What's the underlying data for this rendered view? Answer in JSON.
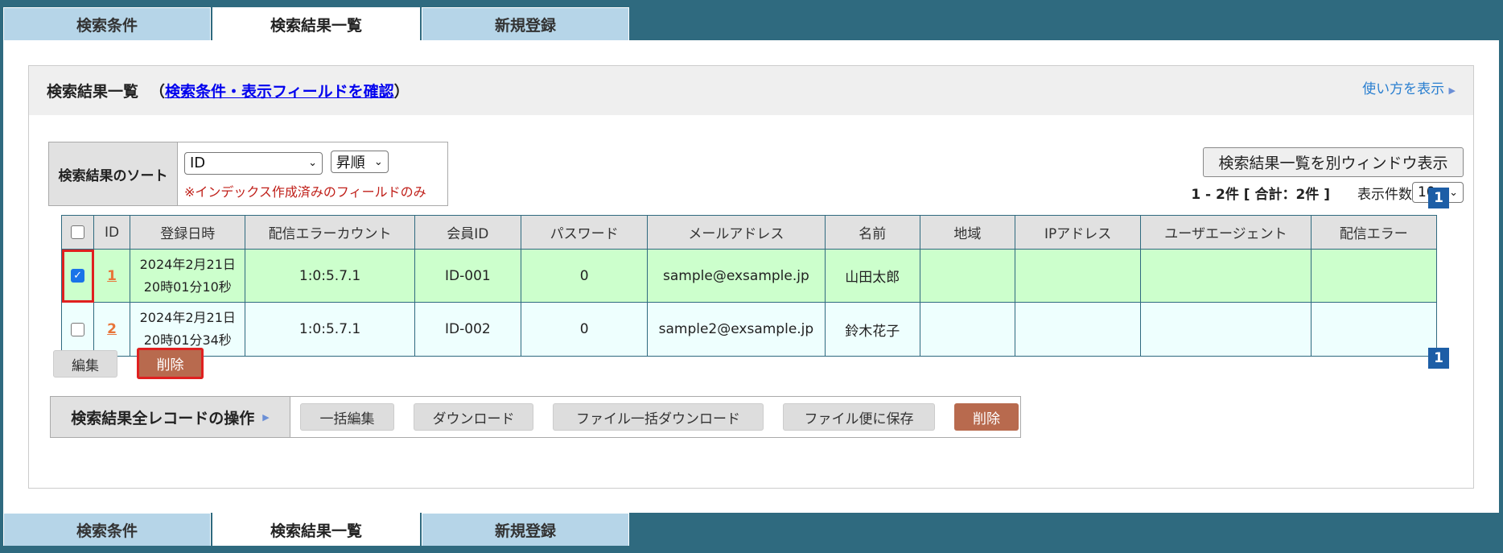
{
  "tabs": [
    {
      "label": "検索条件",
      "active": false
    },
    {
      "label": "検索結果一覧",
      "active": true
    },
    {
      "label": "新規登録",
      "active": false
    }
  ],
  "header": {
    "title": "検索結果一覧",
    "paren_open": "（",
    "link": "検索条件・表示フィールドを確認",
    "paren_close": "）",
    "howto": "使い方を表示",
    "howto_arrow": "▶"
  },
  "sort": {
    "label": "検索結果のソート",
    "field_value": "ID",
    "order_value": "昇順",
    "note": "※インデックス作成済みのフィールドのみ"
  },
  "window_button": "検索結果一覧を別ウィンドウ表示",
  "count": {
    "text": "1 - 2件 [ 合計：2件 ]",
    "per_page_label": "表示件数",
    "per_page_value": "10"
  },
  "page": "1",
  "table": {
    "headers": [
      "ID",
      "登録日時",
      "配信エラーカウント",
      "会員ID",
      "パスワード",
      "メールアドレス",
      "名前",
      "地域",
      "IPアドレス",
      "ユーザエージェント",
      "配信エラー"
    ],
    "rows": [
      {
        "checked": true,
        "id": "1",
        "date": "2024年2月21日",
        "time": "20時01分10秒",
        "error_count": "1:0:5.7.1",
        "member_id": "ID-001",
        "password": "0",
        "email": "sample@exsample.jp",
        "name": "山田太郎",
        "region": "",
        "ip": "",
        "ua": "",
        "error": ""
      },
      {
        "checked": false,
        "id": "2",
        "date": "2024年2月21日",
        "time": "20時01分34秒",
        "error_count": "1:0:5.7.1",
        "member_id": "ID-002",
        "password": "0",
        "email": "sample2@exsample.jp",
        "name": "鈴木花子",
        "region": "",
        "ip": "",
        "ua": "",
        "error": ""
      }
    ]
  },
  "row_actions": {
    "edit": "編集",
    "delete": "削除"
  },
  "ops": {
    "label": "検索結果全レコードの操作",
    "arrow": "▶",
    "bulk_edit": "一括編集",
    "download": "ダウンロード",
    "file_bulk_download": "ファイル一括ダウンロード",
    "save_file_service": "ファイル便に保存",
    "delete": "削除"
  },
  "colors": {
    "accent": "#2f6a7f",
    "tab": "#b6d5e8",
    "delete": "#b86a4e",
    "row_selected": "#ccffcc",
    "row_alt": "#eefffe"
  }
}
